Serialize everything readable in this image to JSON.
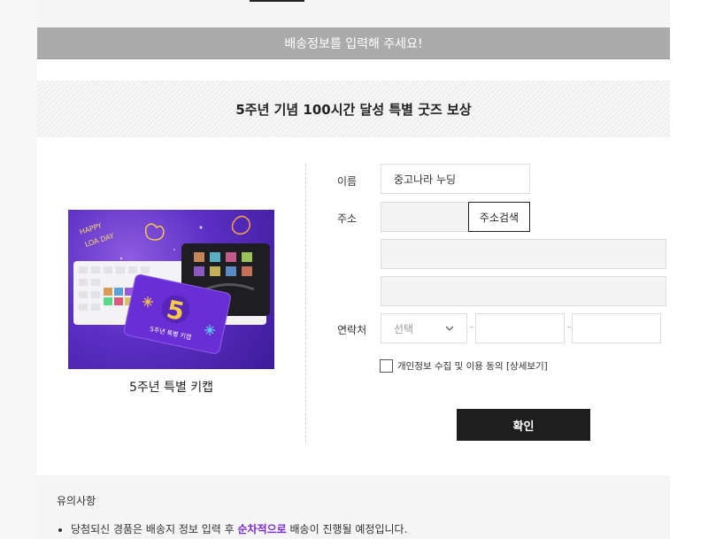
{
  "banner": {
    "text": "배송정보를 입력해 주세요!"
  },
  "title": {
    "text": "5주년 기념 100시간 달성 특별 굿즈 보상"
  },
  "product": {
    "caption": "5주년 특별 키캡",
    "image_texts": {
      "happy": "HAPPY",
      "loaday": "LOA DAY",
      "card_number": "5",
      "card_text": "5주년 특별 키캡"
    }
  },
  "form": {
    "name_label": "이름",
    "name_value": "중고나라 누딩",
    "address_label": "주소",
    "address_search_label": "주소검색",
    "contact_label": "연락처",
    "phone_prefix_value": "선택",
    "privacy_label": "개인정보 수집 및 이용 동의 [상세보기]",
    "confirm_label": "확인"
  },
  "notice": {
    "title": "유의사항",
    "text_before": "당첨되신 경품은 배송지 정보 입력 후 ",
    "text_highlight": "순차적으로",
    "text_after": " 배송이 진행될 예정입니다."
  },
  "colors": {
    "accent": "#7b2bd4",
    "banner_bg": "#ababab",
    "button_bg": "#1e1e1e"
  }
}
